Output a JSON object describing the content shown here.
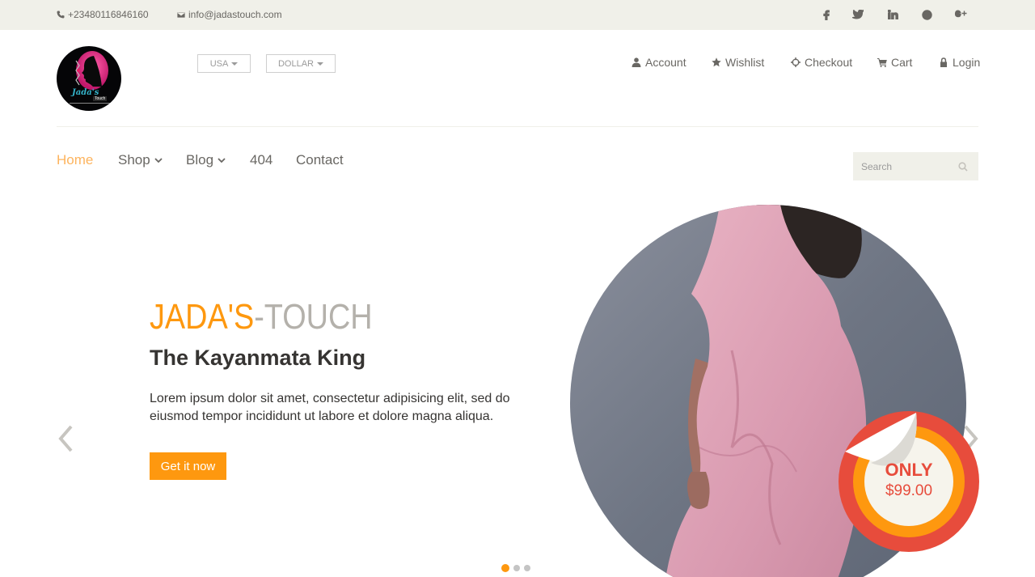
{
  "topbar": {
    "phone": "+23480116846160",
    "email": "info@jadastouch.com",
    "social": [
      "facebook-icon",
      "twitter-icon",
      "linkedin-icon",
      "dribbble-icon",
      "google-plus-icon"
    ]
  },
  "header": {
    "logo_text": "Jada's",
    "logo_subtext": "Touch",
    "country": "USA",
    "currency": "DOLLAR",
    "account_menu": [
      {
        "label": "Account",
        "icon": "user-icon"
      },
      {
        "label": "Wishlist",
        "icon": "star-icon"
      },
      {
        "label": "Checkout",
        "icon": "crosshairs-icon"
      },
      {
        "label": "Cart",
        "icon": "cart-icon"
      },
      {
        "label": "Login",
        "icon": "lock-icon"
      }
    ]
  },
  "nav": {
    "items": [
      {
        "label": "Home",
        "active": true
      },
      {
        "label": "Shop",
        "dropdown": true
      },
      {
        "label": "Blog",
        "dropdown": true
      },
      {
        "label": "404"
      },
      {
        "label": "Contact"
      }
    ],
    "search_placeholder": "Search"
  },
  "slider": {
    "brand_part1": "JADA'S",
    "brand_part2": "-TOUCH",
    "headline": "The Kayanmata King",
    "description": "Lorem ipsum dolor sit amet, consectetur adipisicing elit, sed do eiusmod tempor incididunt ut labore et dolore magna aliqua.",
    "cta": "Get it now",
    "price_label": "ONLY",
    "price_value": "$99.00",
    "slide_count": 3,
    "active_slide": 1
  },
  "colors": {
    "accent": "#fe980f",
    "price_ring": "#e74c3c",
    "topbar_bg": "#f0f0e9",
    "text": "#696763"
  }
}
